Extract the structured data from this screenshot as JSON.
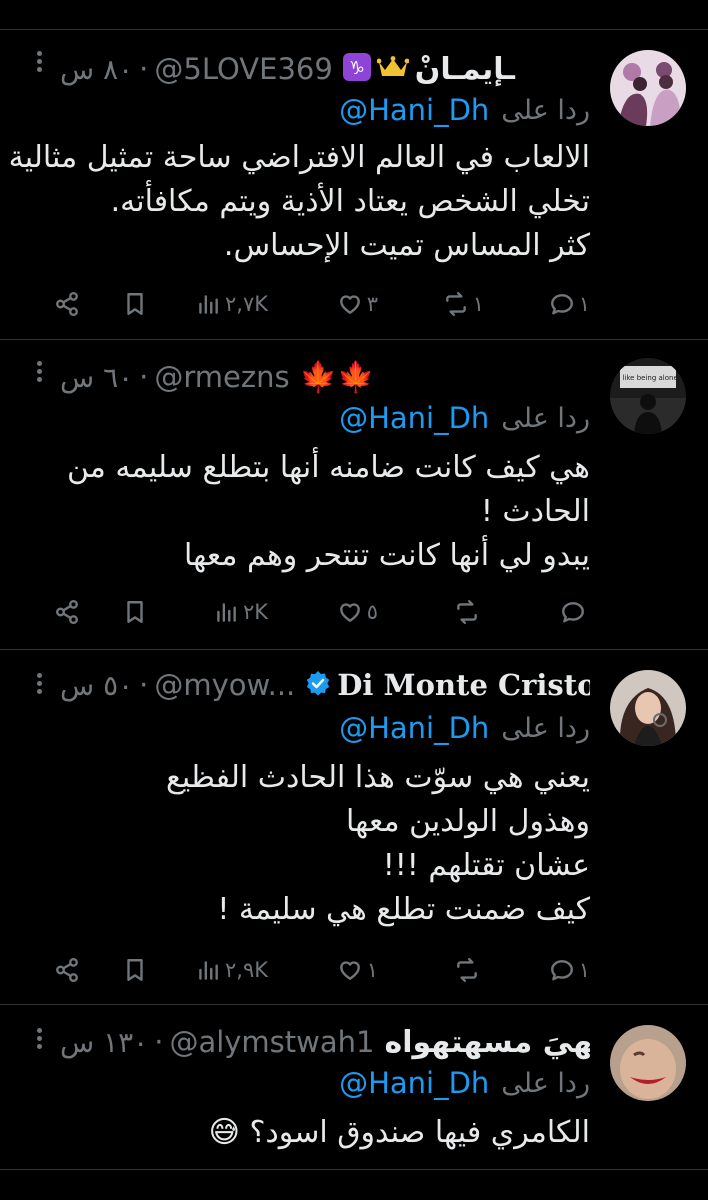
{
  "tweets": [
    {
      "name": "ـإيمـانْ",
      "handle": "@5LOVE369",
      "time": "٨٠ س",
      "reply_prefix": "ردا على",
      "reply_to": "@Hani_Dh",
      "lines": [
        "الالعاب في العالم الافتراضي ساحة تمثيل مثالية",
        "تخلي الشخص يعتاد الأذية ويتم مكافأته.",
        "كثر المساس تميت الإحساس."
      ],
      "replies": "١",
      "reposts": "١",
      "likes": "٣",
      "views": "٢,٧K",
      "badges": [
        "capricorn-icon",
        "crown-icon"
      ]
    },
    {
      "name": "🍁🍁",
      "handle": "@rmezns",
      "time": "٦٠ س",
      "reply_prefix": "ردا على",
      "reply_to": "@Hani_Dh",
      "lines": [
        "هي كيف كانت ضامنه أنها بتطلع سليمه من",
        "الحادث !",
        "يبدو لي أنها كانت تنتحر وهم معها"
      ],
      "replies": "",
      "reposts": "",
      "likes": "٥",
      "views": "٢K",
      "avatar_text": "I like being alone"
    },
    {
      "name": "Di Monte Cristo",
      "handle": "@myow...",
      "time": "٥٠ س",
      "reply_prefix": "ردا على",
      "reply_to": "@Hani_Dh",
      "lines": [
        "يعني هي سوّت هذا الحادث الفظيع",
        "وهذول الولدين معها",
        "عشان تقتلهم !!!",
        "كيف ضمنت تطلع هي سليمة !"
      ],
      "replies": "١",
      "reposts": "",
      "likes": "١",
      "views": "٢,٩K"
    },
    {
      "name": "عالهيَ مسهتهواه",
      "handle": "@alymstwah1",
      "time": "١٣٠ س",
      "reply_prefix": "ردا على",
      "reply_to": "@Hani_Dh",
      "lines": [
        "الكامري فيها صندوق اسود؟ 😅"
      ]
    }
  ],
  "colors": {
    "background": "#000000",
    "text": "#e7e9ea",
    "muted": "#71767b",
    "link": "#1d9bf0",
    "verified": "#1d9bf0",
    "border": "#2f3336"
  }
}
